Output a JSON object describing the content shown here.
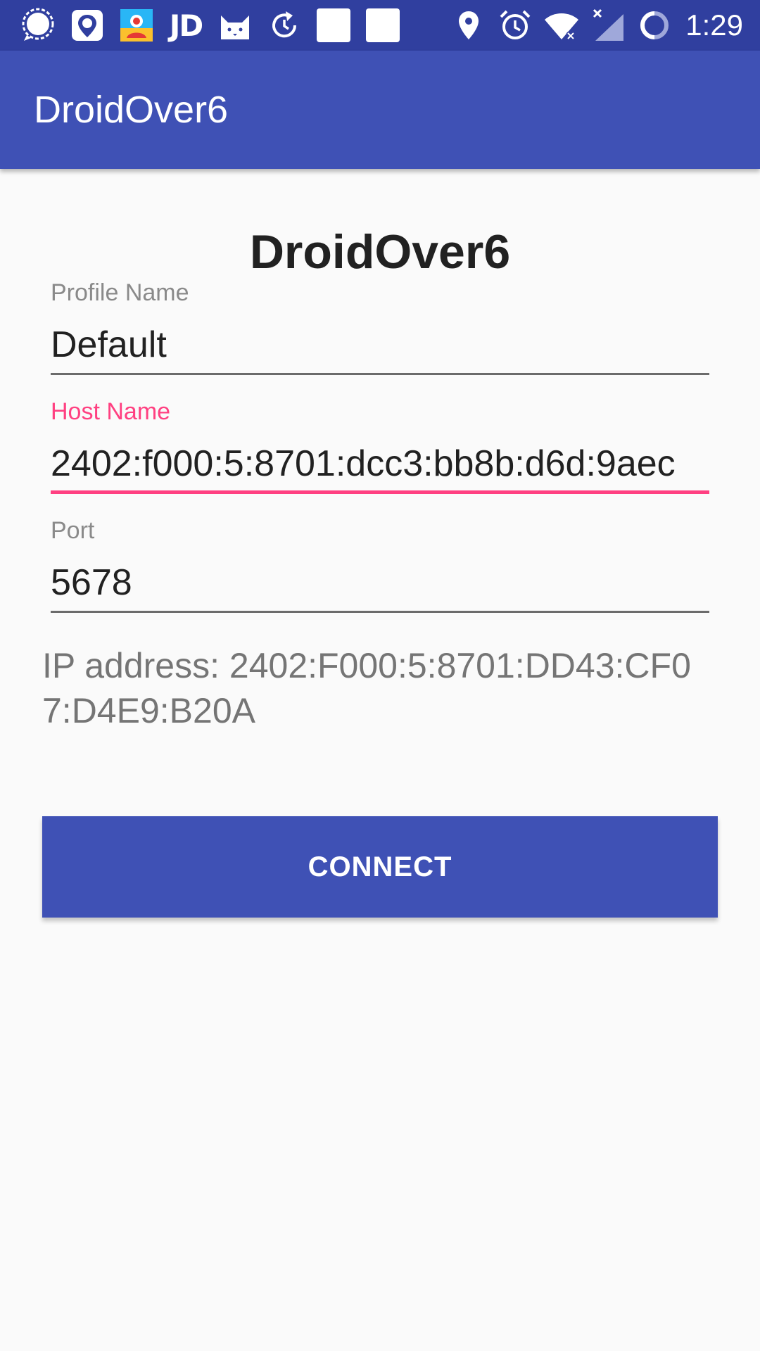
{
  "status_bar": {
    "time": "1:29",
    "jd_label": "JD",
    "left_icons": [
      "signal-messenger-icon",
      "du-map-icon",
      "contacts-app-icon",
      "jd-icon",
      "cat-app-icon",
      "sync-icon",
      "blank-square-icon",
      "blank-square-icon"
    ],
    "right_icons": [
      "location-icon",
      "alarm-icon",
      "wifi-icon",
      "cell-signal-icon",
      "battery-ring-icon"
    ],
    "colors": {
      "background": "#303f9f",
      "foreground": "#ffffff"
    }
  },
  "app_bar": {
    "title": "DroidOver6",
    "color": "#3f51b5"
  },
  "main": {
    "heading": "DroidOver6",
    "fields": [
      {
        "label": "Profile Name",
        "value": "Default",
        "focused": false
      },
      {
        "label": "Host Name",
        "value": "2402:f000:5:8701:dcc3:bb8b:d6d:9aec",
        "focused": true
      },
      {
        "label": "Port",
        "value": "5678",
        "focused": false
      }
    ],
    "ip_address": "IP address: 2402:F000:5:8701:DD43:CF07:D4E9:B20A",
    "connect_label": "CONNECT"
  },
  "colors": {
    "accent": "#ff4081",
    "primary": "#3f51b5",
    "primary_dark": "#303f9f",
    "background": "#fafafa"
  }
}
